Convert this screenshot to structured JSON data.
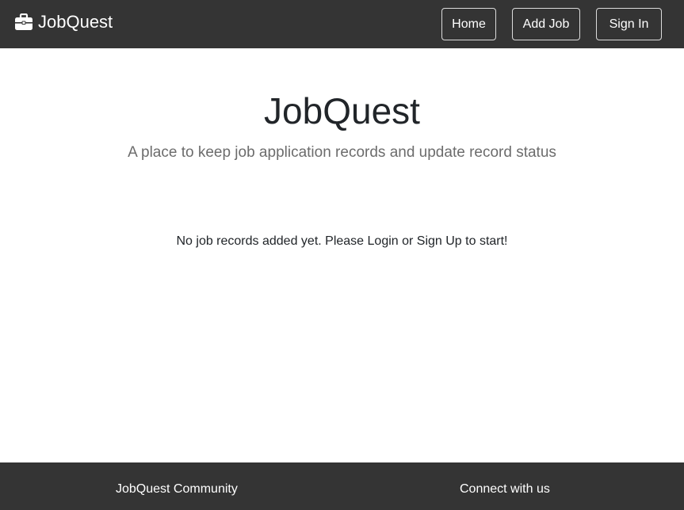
{
  "navbar": {
    "brand": "JobQuest",
    "brand_icon": "briefcase-icon",
    "home_label": "Home",
    "add_job_label": "Add Job",
    "sign_in_label": "Sign In"
  },
  "hero": {
    "title": "JobQuest",
    "subtitle": "A place to keep job application records and update record status"
  },
  "main": {
    "empty_message": "No job records added yet. Please Login or Sign Up to start!"
  },
  "footer": {
    "community_title": "JobQuest Community",
    "connect_title": "Connect with us"
  },
  "colors": {
    "navbar_bg": "#343434",
    "footer_bg": "#343434",
    "text_primary": "#212529",
    "text_muted": "#6c6c6c"
  }
}
